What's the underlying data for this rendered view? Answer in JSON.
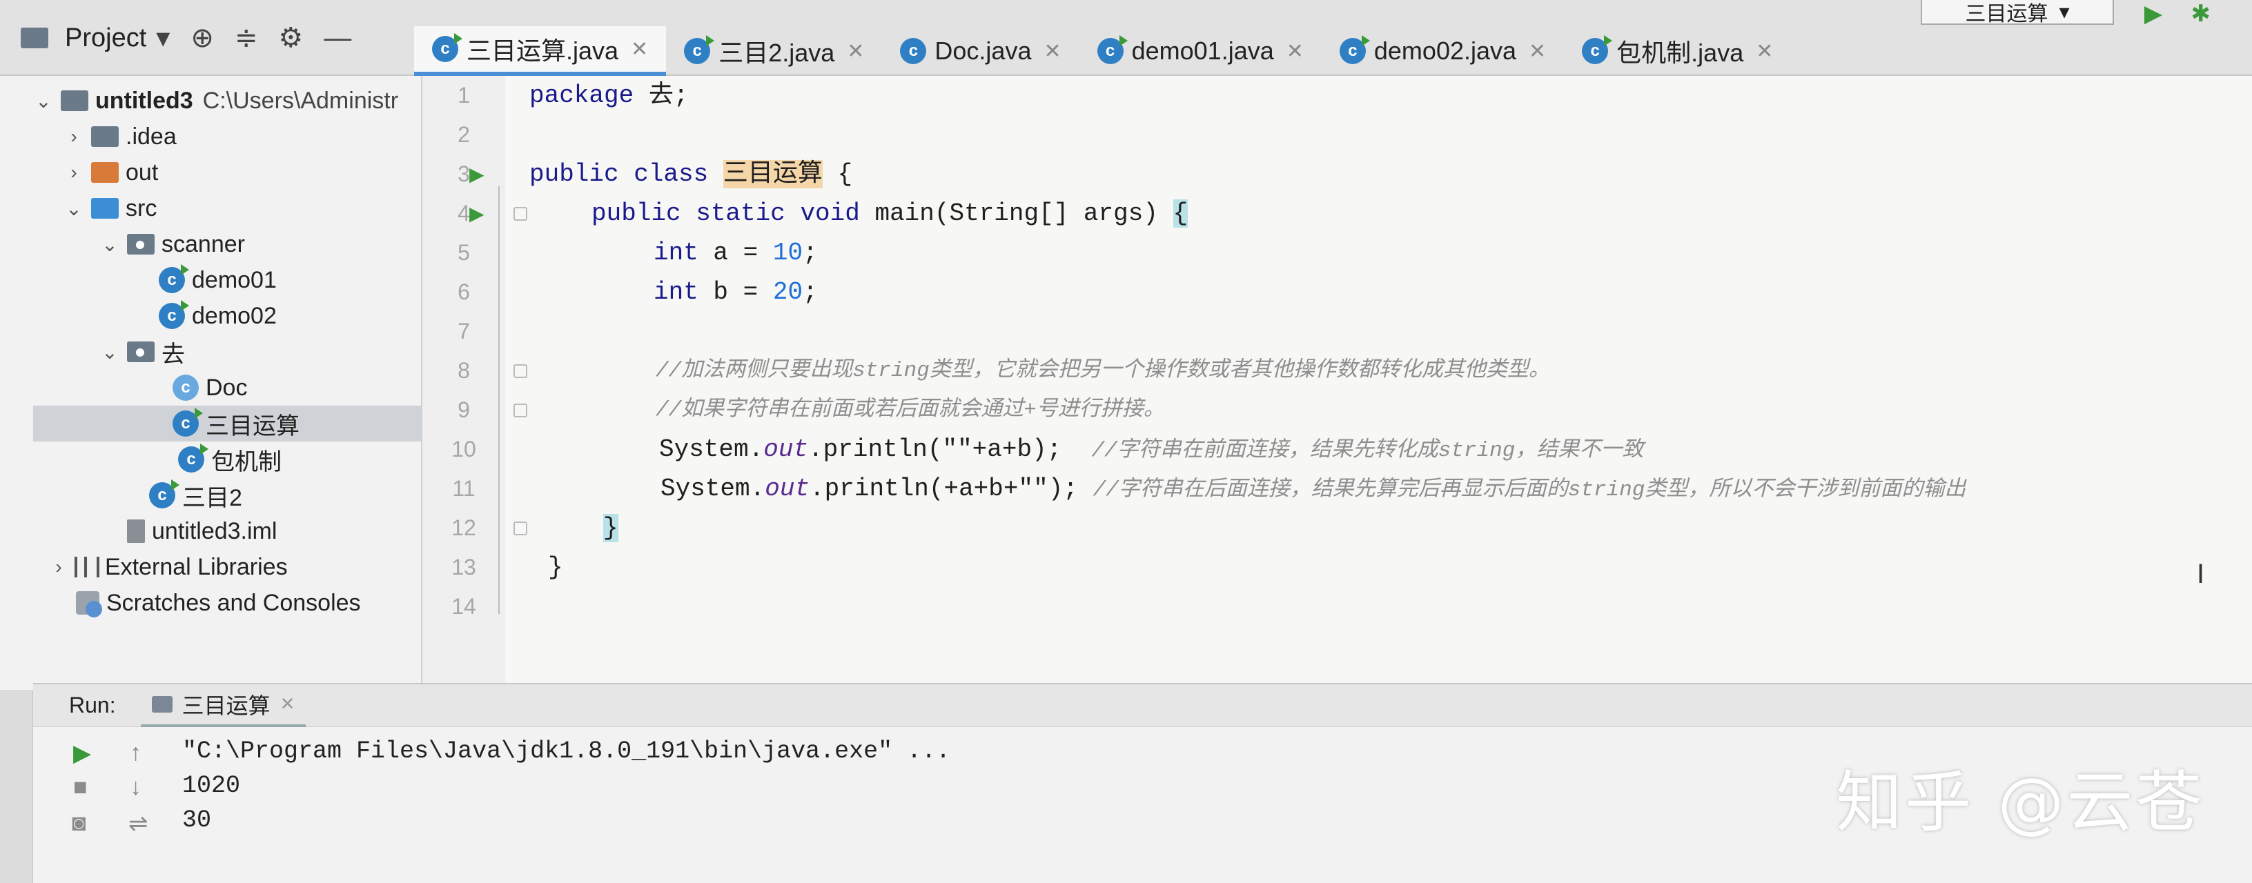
{
  "project_panel": {
    "title": "Project",
    "tree": [
      {
        "label": "untitled3",
        "suffix": "C:\\Users\\Administr"
      },
      {
        "label": ".idea"
      },
      {
        "label": "out"
      },
      {
        "label": "src"
      },
      {
        "label": "scanner"
      },
      {
        "label": "demo01"
      },
      {
        "label": "demo02"
      },
      {
        "label": "去"
      },
      {
        "label": "Doc"
      },
      {
        "label": "三目运算"
      },
      {
        "label": "包机制"
      },
      {
        "label": "三目2"
      },
      {
        "label": "untitled3.iml"
      },
      {
        "label": "External Libraries"
      },
      {
        "label": "Scratches and Consoles"
      }
    ]
  },
  "tabs": [
    {
      "label": "三目运算.java"
    },
    {
      "label": "三目2.java"
    },
    {
      "label": "Doc.java"
    },
    {
      "label": "demo01.java"
    },
    {
      "label": "demo02.java"
    },
    {
      "label": "包机制.java"
    }
  ],
  "run_config": "三目运算",
  "editor": {
    "line_numbers": [
      "1",
      "2",
      "3",
      "4",
      "5",
      "6",
      "7",
      "8",
      "9",
      "10",
      "11",
      "12",
      "13",
      "14"
    ],
    "lines": {
      "l1_kw": "package",
      "l1_rest": " 去;",
      "l3_kw": "public class ",
      "l3_cls": "三目运算",
      "l3_rest": " {",
      "l4_kw": "public static void ",
      "l4_rest": "main(String[] args) ",
      "l4_brace": "{",
      "l5_kw": "int",
      "l5_a": " a = ",
      "l5_num": "10",
      "l5_end": ";",
      "l6_kw": "int",
      "l6_a": " b = ",
      "l6_num": "20",
      "l6_end": ";",
      "l8_cmt": "//加法两侧只要出现string类型，它就会把另一个操作数或者其他操作数都转化成其他类型。",
      "l9_cmt": "//如果字符串在前面或若后面就会通过+号进行拼接。",
      "l10_a": "System.",
      "l10_out": "out",
      "l10_b": ".println(\"\"+a+b);  ",
      "l10_cmt": "//字符串在前面连接，结果先转化成string，结果不一致",
      "l11_a": "System.",
      "l11_out": "out",
      "l11_b": ".println(+a+b+\"\"); ",
      "l11_cmt": "//字符串在后面连接，结果先算完后再显示后面的string类型，所以不会干涉到前面的输出",
      "l12": "}",
      "l13": "}"
    }
  },
  "run_panel": {
    "label": "Run:",
    "tab": "三目运算",
    "output": [
      "\"C:\\Program Files\\Java\\jdk1.8.0_191\\bin\\java.exe\" ...",
      "1020",
      "30"
    ]
  },
  "watermark": "知乎 @云苍",
  "colors": {
    "accent": "#4a8fd6",
    "run_green": "#3a9a3a",
    "class_highlight": "#f5d6a8"
  }
}
